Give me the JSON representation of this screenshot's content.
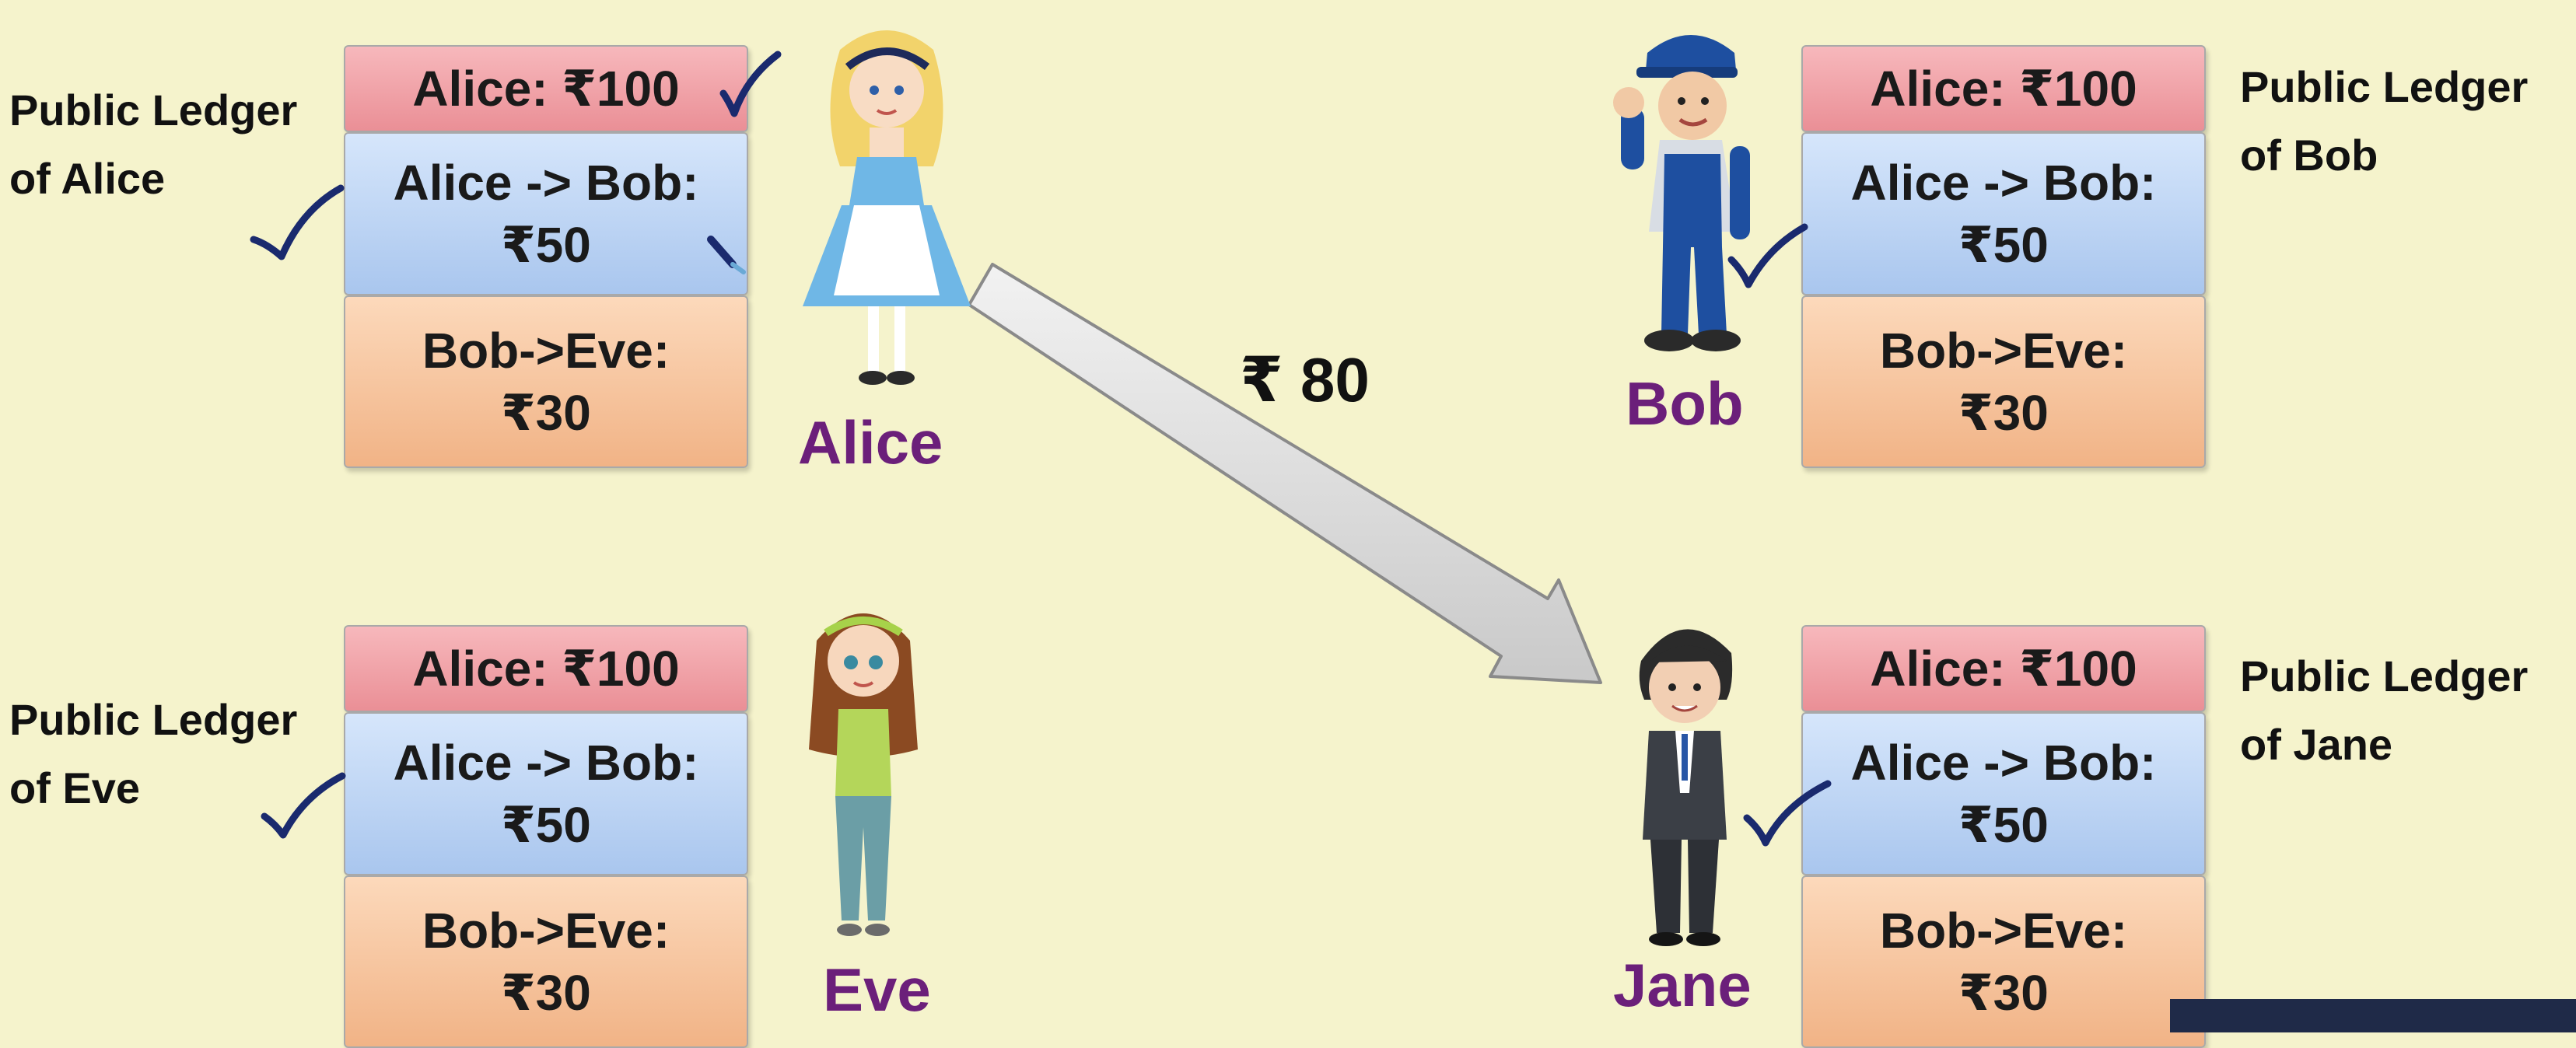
{
  "ledgers": {
    "alice": {
      "caption_line1": "Public Ledger",
      "caption_line2": "of Alice",
      "entry1": "Alice: ₹100",
      "entry2_line1": "Alice -> Bob:",
      "entry2_line2": "₹50",
      "entry3_line1": "Bob->Eve:",
      "entry3_line2": "₹30"
    },
    "bob": {
      "caption_line1": "Public Ledger",
      "caption_line2": "of Bob",
      "entry1": "Alice: ₹100",
      "entry2_line1": "Alice -> Bob:",
      "entry2_line2": "₹50",
      "entry3_line1": "Bob->Eve:",
      "entry3_line2": "₹30"
    },
    "eve": {
      "caption_line1": "Public Ledger",
      "caption_line2": "of Eve",
      "entry1": "Alice: ₹100",
      "entry2_line1": "Alice -> Bob:",
      "entry2_line2": "₹50",
      "entry3_line1": "Bob->Eve:",
      "entry3_line2": "₹30"
    },
    "jane": {
      "caption_line1": "Public Ledger",
      "caption_line2": "of Jane",
      "entry1": "Alice: ₹100",
      "entry2_line1": "Alice -> Bob:",
      "entry2_line2": "₹50",
      "entry3_line1": "Bob->Eve:",
      "entry3_line2": "₹30"
    }
  },
  "people": {
    "alice": "Alice",
    "bob": "Bob",
    "eve": "Eve",
    "jane": "Jane"
  },
  "transfer": {
    "amount": "₹ 80"
  },
  "colors": {
    "background": "#f5f3cc",
    "name_text": "#6b1f7a",
    "checkmark": "#1a2a6e",
    "row1": "#ee959c",
    "row2": "#b3ccef",
    "row3": "#f4bc93",
    "arrow": "#d4d4d4"
  }
}
